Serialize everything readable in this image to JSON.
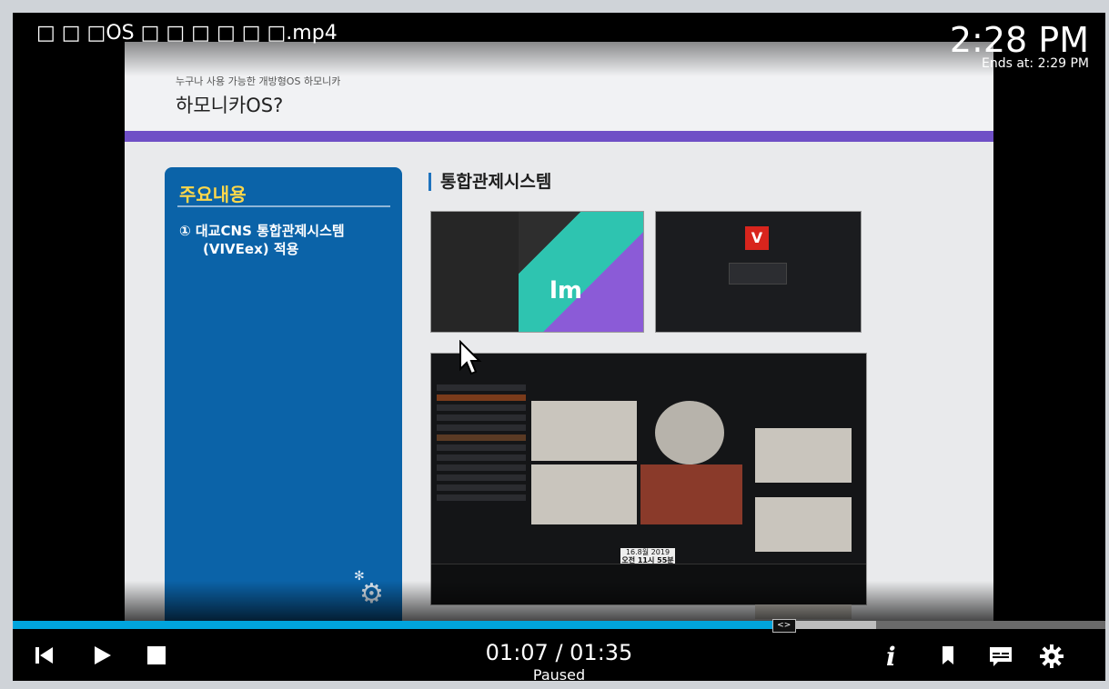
{
  "player": {
    "title": "□ □ □OS □ □ □ □ □ □.mp4",
    "clock": "2:28 PM",
    "ends_at": "Ends at: 2:29 PM",
    "current_time": "01:07",
    "duration": "01:35",
    "time_display": "01:07 / 01:35",
    "status": "Paused",
    "progress": 0.705,
    "buffered": 0.79,
    "accent_color": "#00a4dc"
  },
  "controls": {
    "skip_previous": "skip-previous-icon",
    "play": "play-icon",
    "stop": "stop-icon",
    "info": "info-icon",
    "bookmark": "bookmark-icon",
    "subtitles": "subtitles-icon",
    "settings": "gear-icon"
  },
  "slide": {
    "kicker": "누구나 사용 가능한 개방형OS 하모니카",
    "title": "하모니카OS?",
    "panel_heading": "주요내용",
    "panel_item_line1": "① 대교CNS 통합관제시스템",
    "panel_item_line2": "(VIVEex) 적용",
    "section_title": "통합관제시스템",
    "logo_letter": "V",
    "timeline_date": "16.8월 2019",
    "timeline_time": "오전 11시 55분 33초"
  }
}
